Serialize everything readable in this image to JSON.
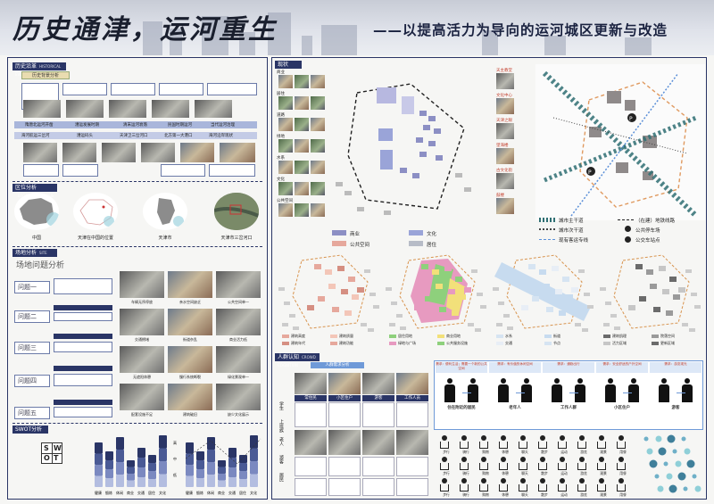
{
  "header": {
    "title": "历史通津，运河重生",
    "subtitle": "——以提高活力为导向的运河城区更新与改造"
  },
  "sections": {
    "history": "历史沿革",
    "history_sub": "HISTORICAL EVOLUTION",
    "background": "历史背景分析",
    "location": "区位分析",
    "location_sub": "LOCATION ANALYSIS",
    "site": "场地分析",
    "site_sub": "SITE ANALYSIS",
    "site_problem": "场地问题分析",
    "swot": "SWOT分析",
    "status": "现状",
    "people": "人群认知",
    "people_sub": "CROWD COGNITION",
    "people_card": "人群需求分析"
  },
  "history": {
    "era_row1": [
      "隋唐北运河开凿",
      "漕运发展时期",
      "清末运河衰落",
      "民国时期运河",
      "当代运河治理"
    ],
    "era_row2": [
      "海河航运三岔河",
      "漕运码头",
      "天津卫三岔河口",
      "北方第一大港口",
      "海河沿岸现状"
    ]
  },
  "location": {
    "labels": [
      "中国",
      "天津在中国的位置",
      "天津市",
      "天津市三岔河口"
    ]
  },
  "problems": {
    "labels": [
      "问题一",
      "问题二",
      "问题三",
      "问题四",
      "问题五"
    ],
    "photo_captions": [
      "车辆无序停放",
      "亲水空间缺乏",
      "公共空间单一",
      "交通拥堵",
      "街道杂乱",
      "商业活力低",
      "无遮阳休憩",
      "慢行系统断裂",
      "绿化景观单一",
      "配套设施不足",
      "建筑破旧",
      "缺少文化展示"
    ]
  },
  "swot": {
    "letters": [
      "S",
      "W",
      "O",
      "T"
    ],
    "x_labels": [
      "健康",
      "锻炼",
      "休闲",
      "商业",
      "交通",
      "居住",
      "文化"
    ],
    "left_levels": [
      "高",
      "中",
      "低"
    ],
    "right_levels": [
      "高",
      "中",
      "低"
    ]
  },
  "status": {
    "photo_rows": [
      "商业",
      "居住",
      "道路",
      "绿地",
      "水系",
      "文化",
      "公共空间"
    ],
    "legend": [
      {
        "label": "商业",
        "color": "#8c8fc4"
      },
      {
        "label": "文化",
        "color": "#9aa4d8"
      },
      {
        "label": "公共空间",
        "color": "#e6a89c"
      },
      {
        "label": "居住",
        "color": "#b7bcc7"
      }
    ],
    "right_photo_labels": [
      "天主教堂",
      "文化中心",
      "天津之眼",
      "望海楼",
      "古文化街",
      "鼓楼"
    ],
    "map_legend": [
      {
        "label": "城市主干道",
        "kind": "solid"
      },
      {
        "label": "（在建）地铁线路",
        "kind": "dash"
      },
      {
        "label": "城市次干道",
        "kind": "dot"
      },
      {
        "label": "公共停车场",
        "kind": "p"
      },
      {
        "label": "现有客运专线",
        "kind": "thin"
      },
      {
        "label": "公交车站点",
        "kind": "bus"
      }
    ],
    "bottom_legends": [
      [
        "建筑高度",
        "建筑质量",
        "建筑年代",
        "建筑功能"
      ],
      [
        "居住用地",
        "商业用地",
        "绿地与广场",
        "公共服务设施"
      ],
      [
        "水系",
        "街道",
        "交通",
        "节点"
      ],
      [
        "建筑肌理",
        "院落空间",
        "活力区域",
        "更新区域"
      ]
    ]
  },
  "people": {
    "groups": [
      "学生",
      "上班族",
      "老人",
      "游客",
      "居民"
    ],
    "columns": [
      "常住民",
      "小区住户",
      "游客",
      "工作人员"
    ],
    "flow_headers": [
      "需求：便利生活；需要一个新的公共空间",
      "需求：有价值的休闲空间",
      "需求：通勤出行",
      "需求：安全舒适的户外空间",
      "需求：游览观光"
    ],
    "flow_people": [
      "住在附近的居民",
      "老年人",
      "工作人群",
      "小区住户",
      "游客"
    ],
    "icon_labels": [
      "步行",
      "骑行",
      "购物",
      "休憩",
      "聊天",
      "散步",
      "运动",
      "游览",
      "观景",
      "用餐"
    ]
  }
}
